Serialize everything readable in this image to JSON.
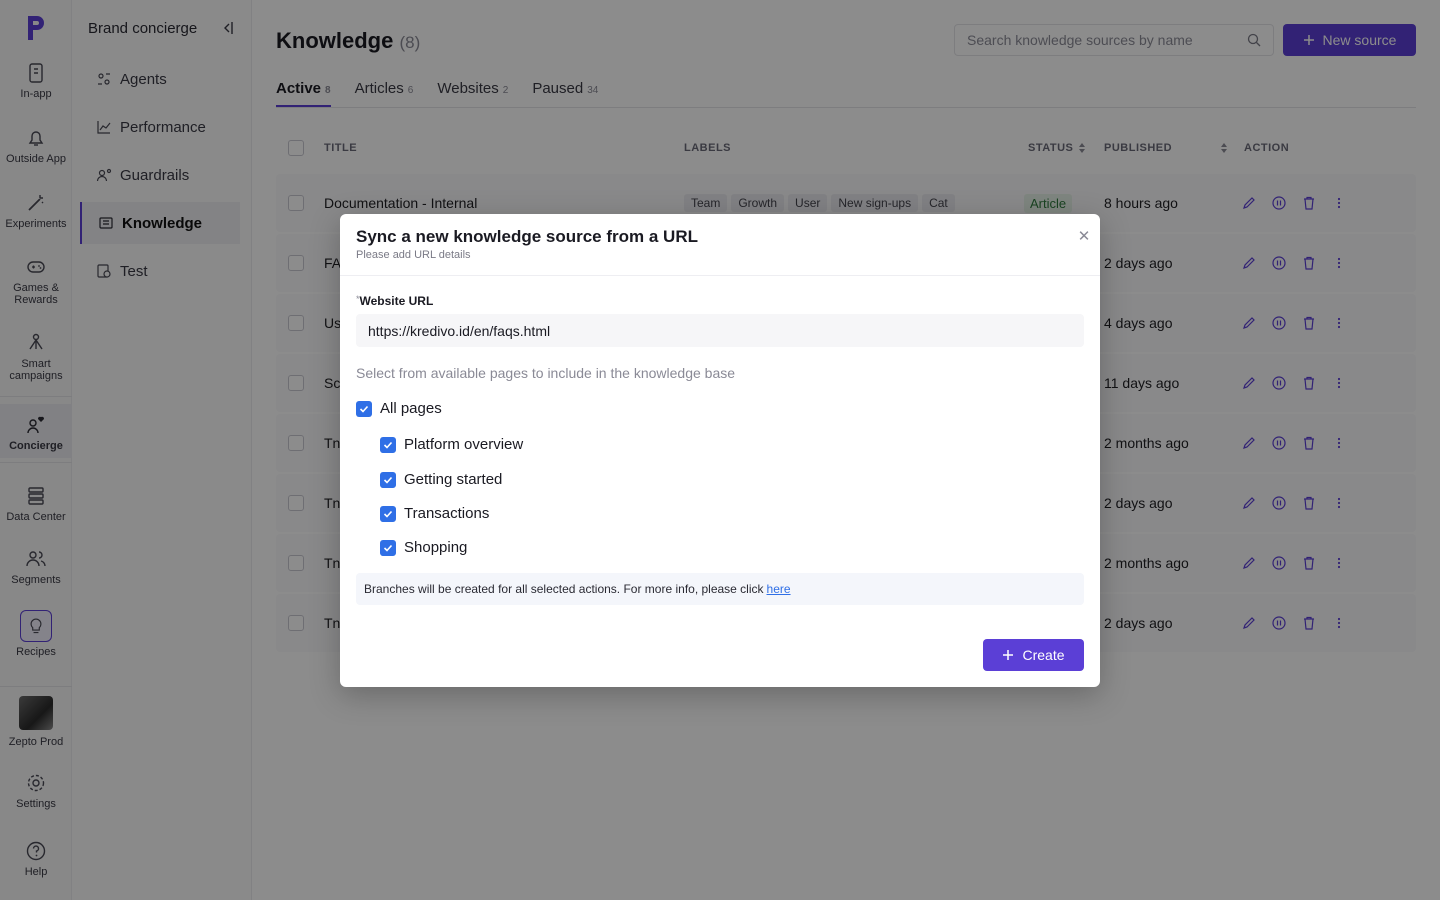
{
  "rail": {
    "items": [
      {
        "label": "In-app",
        "icon": "in-app-icon"
      },
      {
        "label": "Outside App",
        "icon": "bell-icon"
      },
      {
        "label": "Experiments",
        "icon": "magic-wand-icon"
      },
      {
        "label": "Games &\nRewards",
        "icon": "gamepad-icon"
      },
      {
        "label": "Smart\ncampaigns",
        "icon": "flow-icon"
      },
      {
        "label": "Concierge",
        "icon": "concierge-icon"
      },
      {
        "label": "Data Center",
        "icon": "database-icon"
      },
      {
        "label": "Segments",
        "icon": "users-icon"
      },
      {
        "label": "Recipes",
        "icon": "lightbulb-icon"
      },
      {
        "label": "Zepto Prod",
        "icon": "avatar"
      },
      {
        "label": "Settings",
        "icon": "gear-icon"
      },
      {
        "label": "Help",
        "icon": "help-icon"
      }
    ]
  },
  "subnav": {
    "title": "Brand concierge",
    "items": [
      {
        "label": "Agents"
      },
      {
        "label": "Performance"
      },
      {
        "label": "Guardrails"
      },
      {
        "label": "Knowledge"
      },
      {
        "label": "Test"
      }
    ]
  },
  "main": {
    "title": "Knowledge",
    "count": "(8)",
    "search_placeholder": "Search knowledge sources by name",
    "new_source_label": "New source",
    "tabs": [
      {
        "label": "Active",
        "count": "8"
      },
      {
        "label": "Articles",
        "count": "6"
      },
      {
        "label": "Websites",
        "count": "2"
      },
      {
        "label": "Paused",
        "count": "34"
      }
    ],
    "columns": [
      "TITLE",
      "LABELS",
      "STATUS",
      "PUBLISHED",
      "ACTION"
    ],
    "rows": [
      {
        "title": "Documentation - Internal",
        "labels": [
          "Team",
          "Growth",
          "User",
          "New sign-ups",
          "Cat"
        ],
        "status": "Article",
        "published": "8 hours ago"
      },
      {
        "title": "FA",
        "published": "2 days ago"
      },
      {
        "title": "Us",
        "published": "4 days ago"
      },
      {
        "title": "Sc",
        "published": "11 days ago"
      },
      {
        "title": "Tn",
        "published": "2 months ago"
      },
      {
        "title": "Tn",
        "published": "2 days ago"
      },
      {
        "title": "Tn",
        "published": "2 months ago"
      },
      {
        "title": "Tn",
        "published": "2 days ago"
      }
    ]
  },
  "modal": {
    "title": "Sync a new knowledge source from a URL",
    "subtitle": "Please add URL details",
    "url_label": "Website URL",
    "url_value": "https://kredivo.id/en/faqs.html",
    "pages_hint": "Select from available pages to include in the knowledge base",
    "all_pages_label": "All pages",
    "pages": [
      {
        "label": "Platform overview",
        "checked": true
      },
      {
        "label": "Getting started",
        "checked": true
      },
      {
        "label": "Transactions",
        "checked": true
      },
      {
        "label": "Shopping",
        "checked": true
      }
    ],
    "info_text": "Branches will be created for all selected actions. For more info, please click",
    "info_link": "here",
    "create_label": "Create"
  },
  "colors": {
    "accent": "#5b3fd6",
    "checkbox": "#2f6fe6"
  }
}
